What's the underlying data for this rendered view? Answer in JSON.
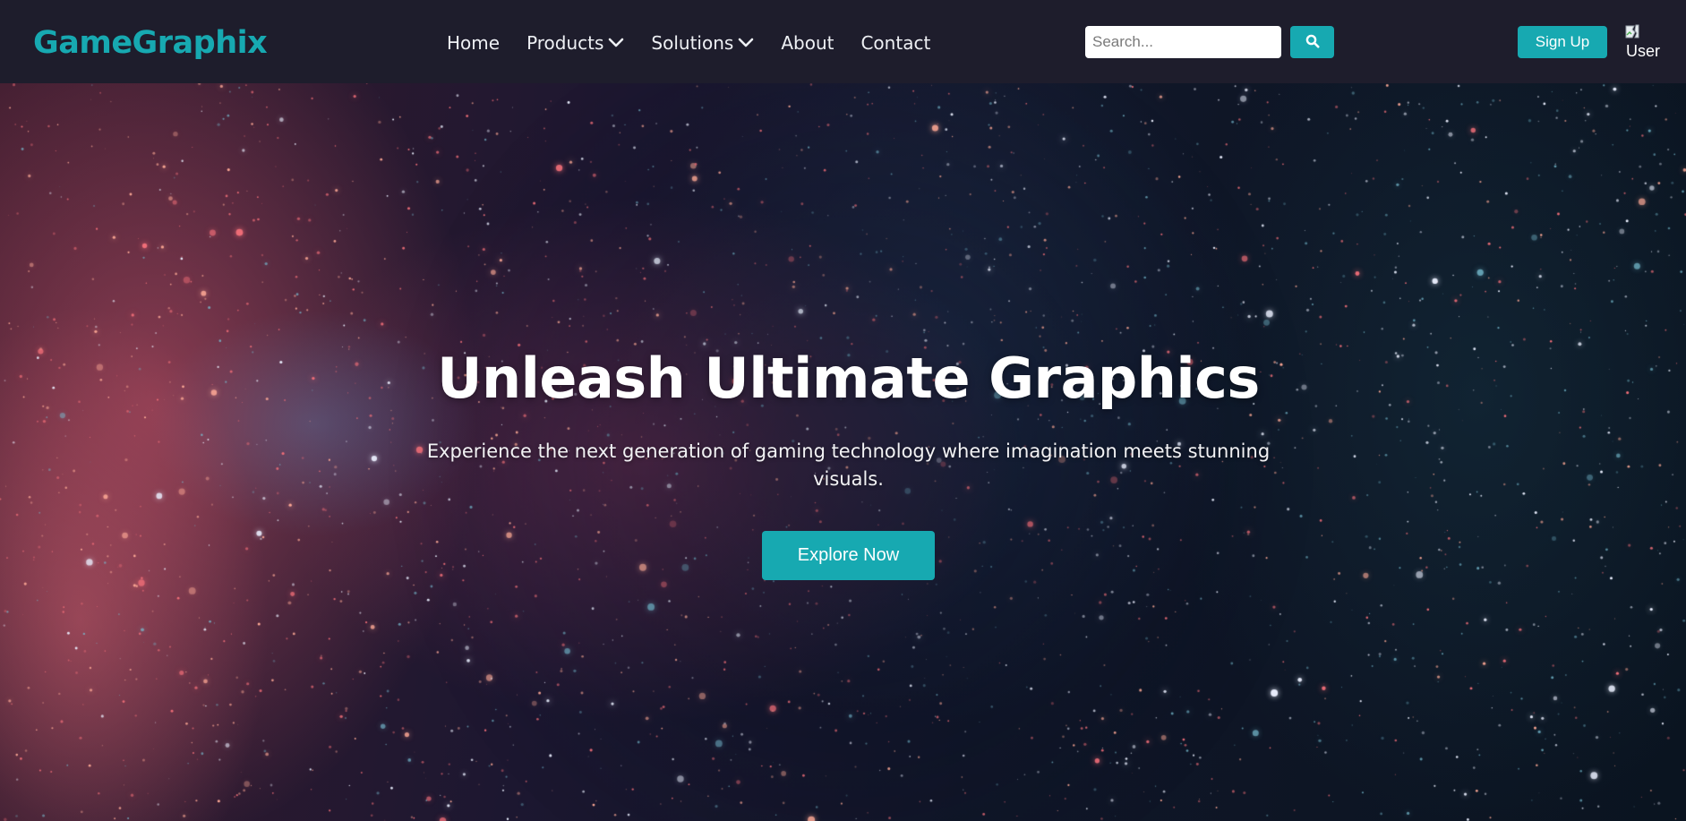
{
  "brand": {
    "name": "GameGraphix",
    "accent_color": "#17a9b1"
  },
  "nav": {
    "items": [
      {
        "label": "Home",
        "has_dropdown": false
      },
      {
        "label": "Products",
        "has_dropdown": true
      },
      {
        "label": "Solutions",
        "has_dropdown": true
      },
      {
        "label": "About",
        "has_dropdown": false
      },
      {
        "label": "Contact",
        "has_dropdown": false
      }
    ],
    "background_color": "#1e1d2c"
  },
  "search": {
    "placeholder": "Search...",
    "value": "",
    "button_icon": "search-icon"
  },
  "account": {
    "signup_label": "Sign Up",
    "avatar_alt": "User",
    "avatar_icon": "broken-image-icon"
  },
  "hero": {
    "title": "Unleash Ultimate Graphics",
    "subtitle": "Experience the next generation of gaming technology where imagination meets stunning visuals.",
    "cta_label": "Explore Now",
    "background": "particle-galaxy-image"
  }
}
